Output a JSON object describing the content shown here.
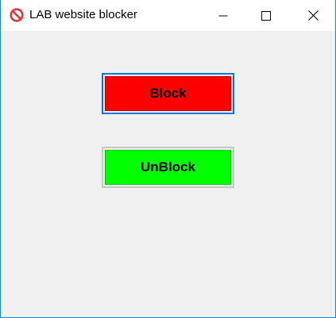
{
  "window": {
    "title": "LAB website blocker",
    "icon": "prohibited-icon"
  },
  "caption_buttons": {
    "minimize": "minimize-icon",
    "maximize": "maximize-icon",
    "close": "close-icon"
  },
  "buttons": {
    "block_label": "Block",
    "block_color": "#ff0000",
    "unblock_label": "UnBlock",
    "unblock_color": "#00ff00"
  },
  "colors": {
    "accent": "#0078d7",
    "background": "#f0f0f0"
  }
}
